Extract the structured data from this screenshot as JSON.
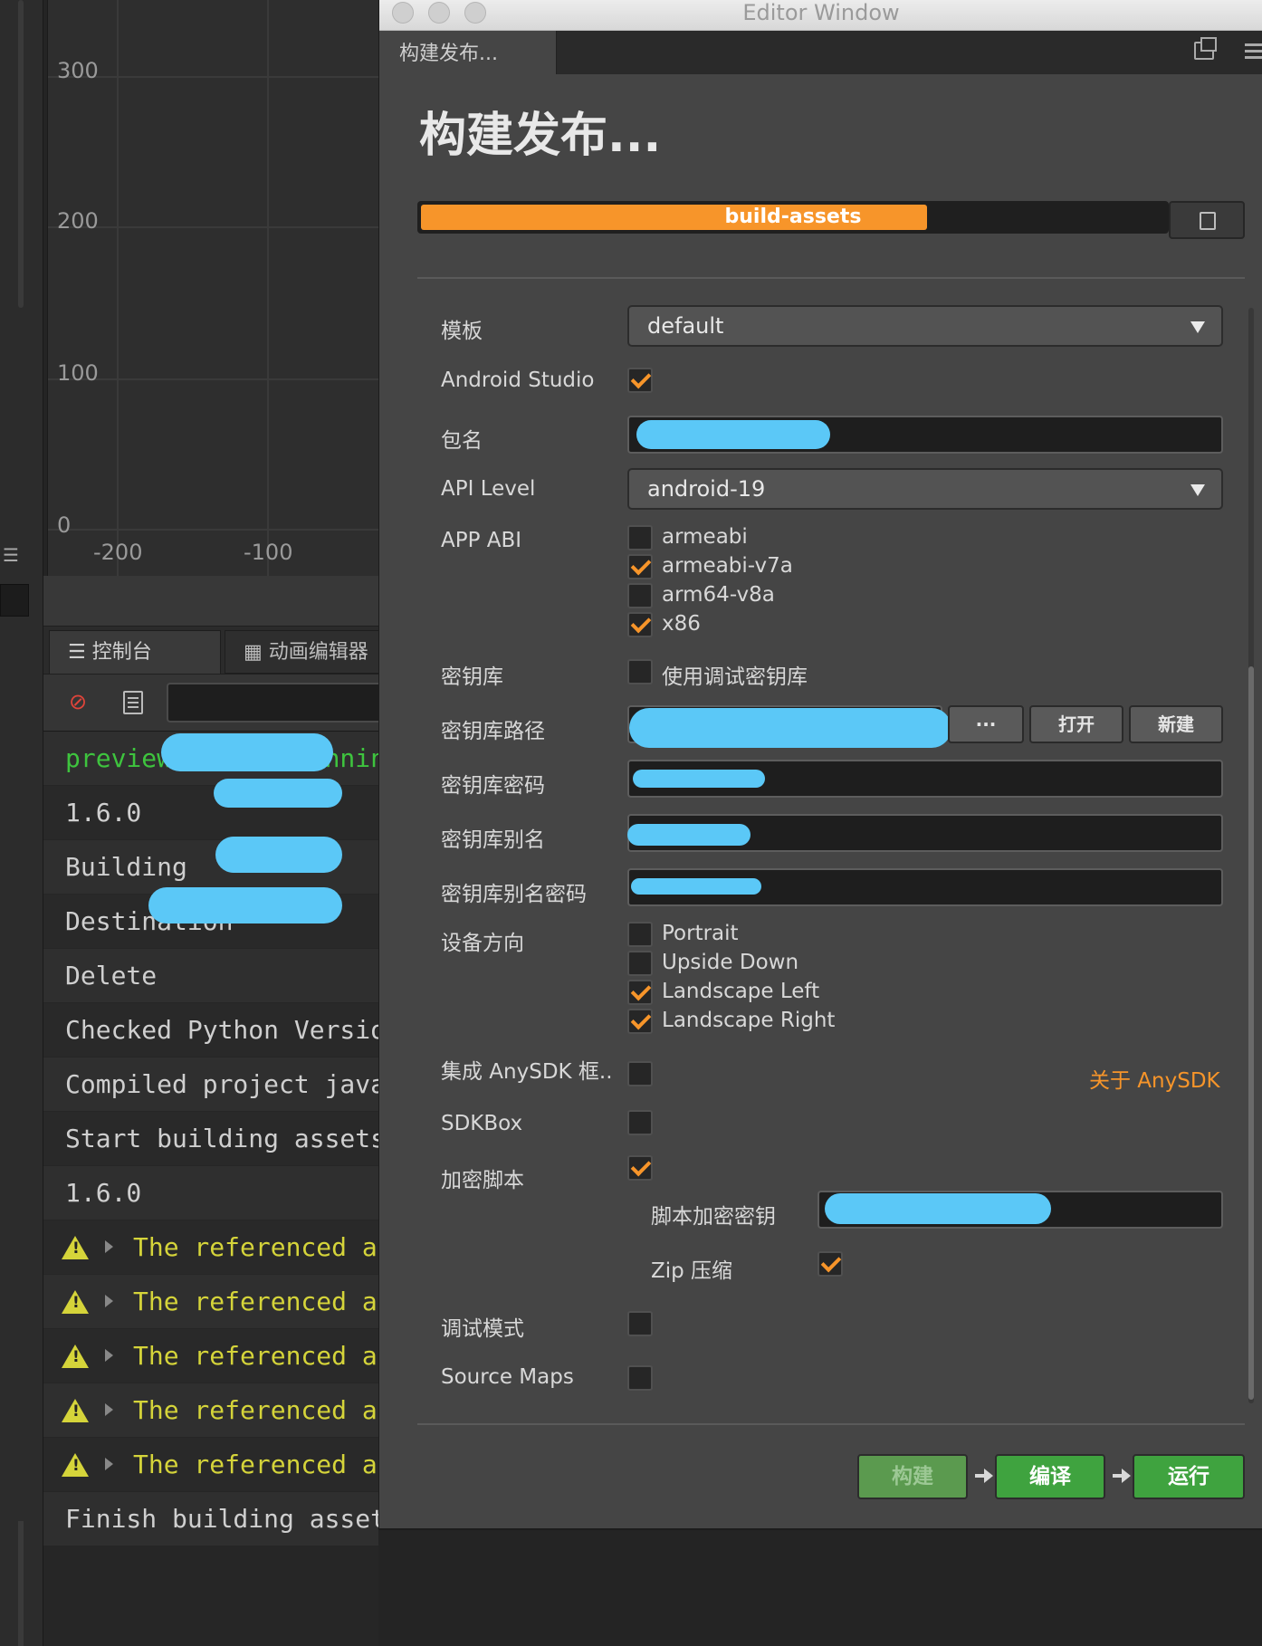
{
  "background": {
    "graph": {
      "y_ticks": [
        "300",
        "200",
        "100",
        "0"
      ],
      "x_ticks": [
        "-200",
        "-100"
      ]
    },
    "console": {
      "tabs": [
        "控制台",
        "动画编辑器"
      ],
      "rows": [
        {
          "text": "preview server runnin",
          "type": "green"
        },
        {
          "text": "1.6.0",
          "type": "normal"
        },
        {
          "text": "Building",
          "type": "normal"
        },
        {
          "text": "Destination",
          "type": "normal"
        },
        {
          "text": "Delete",
          "type": "normal"
        },
        {
          "text": "Checked Python Versio",
          "type": "normal"
        },
        {
          "text": "Compiled project java",
          "type": "normal"
        },
        {
          "text": "Start building assets",
          "type": "normal"
        },
        {
          "text": "1.6.0",
          "type": "normal"
        },
        {
          "text": "The referenced a",
          "type": "warn"
        },
        {
          "text": "The referenced a",
          "type": "warn"
        },
        {
          "text": "The referenced a",
          "type": "warn"
        },
        {
          "text": "The referenced a",
          "type": "warn"
        },
        {
          "text": "The referenced a",
          "type": "warn"
        },
        {
          "text": "Finish building asset",
          "type": "normal"
        }
      ]
    }
  },
  "window": {
    "title": "Editor Window",
    "tab": "构建发布...",
    "heading": "构建发布...",
    "progress": {
      "label": "build-assets",
      "fraction": 0.68
    },
    "colors": {
      "accent": "#f7952a",
      "build_button": "#5b9a4f",
      "action_button": "#3fa33f"
    }
  },
  "form": {
    "template": {
      "label": "模板",
      "value": "default"
    },
    "android_studio": {
      "label": "Android Studio",
      "checked": true
    },
    "package_name": {
      "label": "包名"
    },
    "api_level": {
      "label": "API Level",
      "value": "android-19"
    },
    "app_abi": {
      "label": "APP ABI",
      "options": [
        {
          "label": "armeabi",
          "checked": false
        },
        {
          "label": "armeabi-v7a",
          "checked": true
        },
        {
          "label": "arm64-v8a",
          "checked": false
        },
        {
          "label": "x86",
          "checked": true
        }
      ]
    },
    "keystore": {
      "label": "密钥库",
      "option": "使用调试密钥库",
      "checked": false
    },
    "keystore_path": {
      "label": "密钥库路径",
      "browse": "···",
      "open": "打开",
      "new": "新建"
    },
    "keystore_password": {
      "label": "密钥库密码"
    },
    "keystore_alias": {
      "label": "密钥库别名"
    },
    "keystore_alias_password": {
      "label": "密钥库别名密码"
    },
    "orientation": {
      "label": "设备方向",
      "options": [
        {
          "label": "Portrait",
          "checked": false
        },
        {
          "label": "Upside Down",
          "checked": false
        },
        {
          "label": "Landscape Left",
          "checked": true
        },
        {
          "label": "Landscape Right",
          "checked": true
        }
      ]
    },
    "anysdk": {
      "label": "集成 AnySDK 框..",
      "checked": false,
      "link": "关于 AnySDK"
    },
    "sdkbox": {
      "label": "SDKBox",
      "checked": false
    },
    "encrypt_js": {
      "label": "加密脚本",
      "checked": true
    },
    "encrypt_key": {
      "label": "脚本加密密钥"
    },
    "zip": {
      "label": "Zip 压缩",
      "checked": true
    },
    "debug": {
      "label": "调试模式",
      "checked": false
    },
    "source_maps": {
      "label": "Source Maps",
      "checked": false
    }
  },
  "actions": {
    "build": "构建",
    "compile": "编译",
    "run": "运行"
  }
}
